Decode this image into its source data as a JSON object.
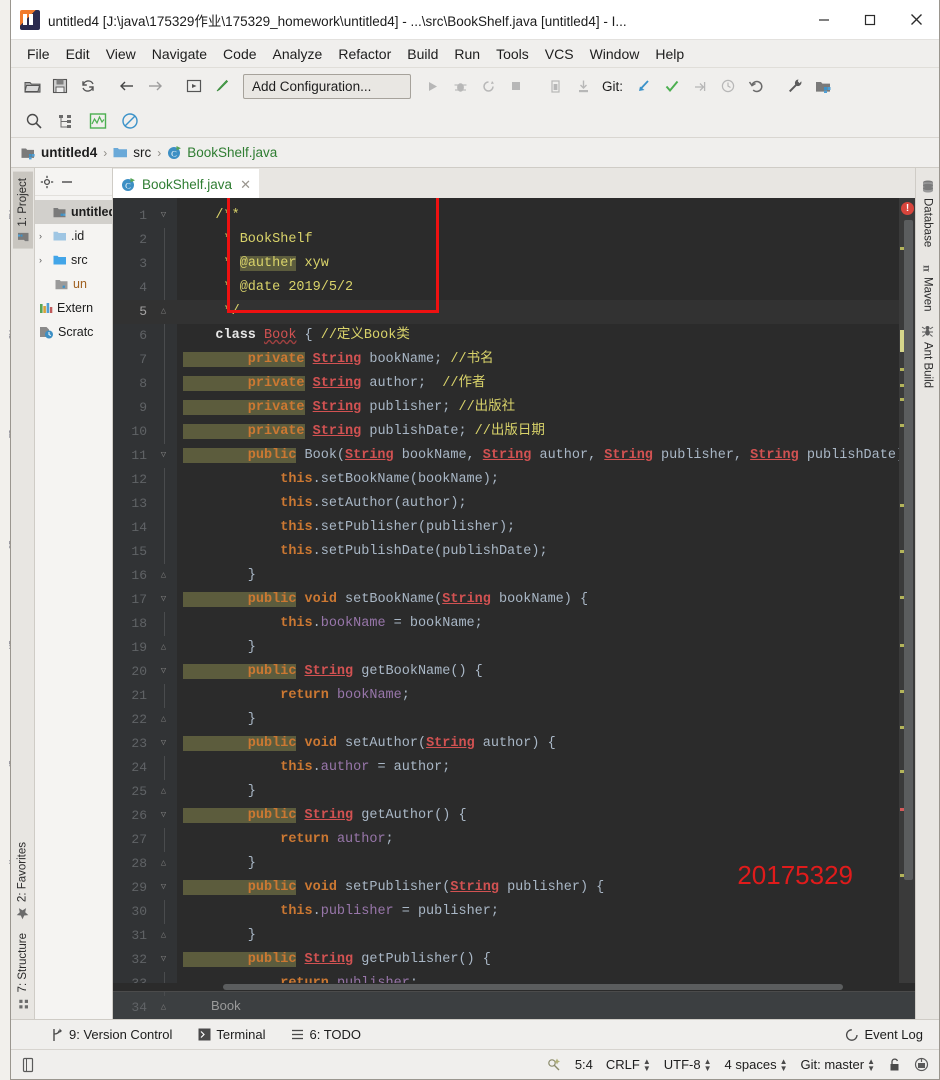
{
  "window": {
    "title": "untitled4 [J:\\java\\175329作业\\175329_homework\\untitled4] - ...\\src\\BookShelf.java [untitled4] - I...",
    "minimize_label": "─",
    "maximize_label": "☐",
    "close_label": "✕",
    "app_icon": "intellij-idea-icon"
  },
  "menubar": {
    "items": [
      {
        "label": "File"
      },
      {
        "label": "Edit"
      },
      {
        "label": "View"
      },
      {
        "label": "Navigate"
      },
      {
        "label": "Code"
      },
      {
        "label": "Analyze"
      },
      {
        "label": "Refactor"
      },
      {
        "label": "Build"
      },
      {
        "label": "Run"
      },
      {
        "label": "Tools"
      },
      {
        "label": "VCS"
      },
      {
        "label": "Window"
      },
      {
        "label": "Help"
      }
    ]
  },
  "toolbar": {
    "run_config": "Add Configuration...",
    "git_label": "Git:",
    "icons": [
      "open-folder-icon",
      "save-all-icon",
      "sync-refresh-icon",
      "back-arrow-icon",
      "forward-arrow-icon",
      "run-anything-icon",
      "build-hammer-icon",
      "run-icon",
      "debug-icon",
      "run-coverage-icon",
      "stop-icon",
      "profiler-icon",
      "attach-process-icon",
      "update-project-icon",
      "commit-icon",
      "push-icon",
      "history-icon",
      "rollback-icon",
      "settings-wrench-icon",
      "project-structure-icon"
    ],
    "row2_icons": [
      "search-everywhere-icon",
      "structure-icon",
      "chart-icon",
      "no-entry-icon"
    ]
  },
  "breadcrumb": {
    "items": [
      {
        "label": "untitled4",
        "icon": "module-icon"
      },
      {
        "label": "src",
        "icon": "folder-icon"
      },
      {
        "label": "BookShelf.java",
        "icon": "java-class-icon"
      }
    ],
    "separator": "›"
  },
  "left_strip": {
    "top": [
      {
        "label": "1: Project",
        "icon": "project-icon",
        "active": true
      }
    ],
    "bottom": [
      {
        "label": "2: Favorites",
        "icon": "star-icon"
      },
      {
        "label": "7: Structure",
        "icon": "structure-grid-icon"
      }
    ]
  },
  "right_strip": {
    "items": [
      {
        "label": "Database",
        "icon": "database-icon"
      },
      {
        "label": "Maven",
        "icon": "maven-m-icon"
      },
      {
        "label": "Ant Build",
        "icon": "ant-icon"
      }
    ]
  },
  "project_panel": {
    "header_icons": [
      "gear-icon",
      "collapse-icon"
    ],
    "tree": [
      {
        "label": "untitled",
        "indent": 0,
        "arrow": "",
        "icon": "module-icon",
        "bold": true,
        "selected": true
      },
      {
        "label": ".id",
        "indent": 1,
        "arrow": "›",
        "icon": "folder-icon",
        "bold": false,
        "selected": false
      },
      {
        "label": "src",
        "indent": 1,
        "arrow": "›",
        "icon": "folder-src-icon",
        "bold": false,
        "selected": false
      },
      {
        "label": "un",
        "indent": 2,
        "arrow": "",
        "icon": "iml-file-icon",
        "bold": false,
        "selected": false,
        "orange": true
      },
      {
        "label": "Extern",
        "indent": 0,
        "arrow": "",
        "icon": "libraries-icon",
        "bold": false,
        "selected": false
      },
      {
        "label": "Scratc",
        "indent": 0,
        "arrow": "",
        "icon": "scratches-icon",
        "bold": false,
        "selected": false
      }
    ]
  },
  "editor": {
    "tab": {
      "label": "BookShelf.java",
      "icon": "java-class-icon",
      "close": "✕"
    },
    "first_line_number": 1,
    "current_line": 5,
    "caret_position": "5:4",
    "bottom_breadcrumb": "Book",
    "watermark": "20175329",
    "error_marker_count": "!",
    "lines": [
      {
        "n": 1,
        "fold": "minus",
        "tokens": [
          {
            "t": "jdoc",
            "s": "    /**"
          }
        ]
      },
      {
        "n": 2,
        "fold": "",
        "tokens": [
          {
            "t": "jdoc",
            "s": "     * BookShelf"
          }
        ]
      },
      {
        "n": 3,
        "fold": "",
        "tokens": [
          {
            "t": "jdoc",
            "s": "     * "
          },
          {
            "t": "jdoct",
            "s": "@auther"
          },
          {
            "t": "jdoc",
            "s": " xyw"
          }
        ]
      },
      {
        "n": 4,
        "fold": "",
        "tokens": [
          {
            "t": "jdoc",
            "s": "     * @date 2019/5/2"
          }
        ]
      },
      {
        "n": 5,
        "fold": "end",
        "tokens": [
          {
            "t": "jdoc",
            "s": "     */"
          }
        ]
      },
      {
        "n": 6,
        "fold": "",
        "tokens": [
          {
            "t": "kwwhite",
            "s": "    class "
          },
          {
            "t": "cls",
            "s": "Book"
          },
          {
            "t": "pln",
            "s": " { "
          },
          {
            "t": "cmt-y",
            "s": "//定义Book类"
          }
        ]
      },
      {
        "n": 7,
        "fold": "",
        "tokens": [
          {
            "t": "kwb",
            "s": "        private"
          },
          {
            "t": "pln",
            "s": " "
          },
          {
            "t": "typ",
            "s": "String"
          },
          {
            "t": "pln",
            "s": " bookName; "
          },
          {
            "t": "cmt-y",
            "s": "//书名"
          }
        ]
      },
      {
        "n": 8,
        "fold": "",
        "tokens": [
          {
            "t": "kwb",
            "s": "        private"
          },
          {
            "t": "pln",
            "s": " "
          },
          {
            "t": "typ",
            "s": "String"
          },
          {
            "t": "pln",
            "s": " author;  "
          },
          {
            "t": "cmt-y",
            "s": "//作者"
          }
        ]
      },
      {
        "n": 9,
        "fold": "",
        "tokens": [
          {
            "t": "kwb",
            "s": "        private"
          },
          {
            "t": "pln",
            "s": " "
          },
          {
            "t": "typ",
            "s": "String"
          },
          {
            "t": "pln",
            "s": " publisher; "
          },
          {
            "t": "cmt-y",
            "s": "//出版社"
          }
        ]
      },
      {
        "n": 10,
        "fold": "",
        "tokens": [
          {
            "t": "kwb",
            "s": "        private"
          },
          {
            "t": "pln",
            "s": " "
          },
          {
            "t": "typ",
            "s": "String"
          },
          {
            "t": "pln",
            "s": " publishDate; "
          },
          {
            "t": "cmt-y",
            "s": "//出版日期"
          }
        ]
      },
      {
        "n": 11,
        "fold": "minus",
        "tokens": [
          {
            "t": "kwb",
            "s": "        public"
          },
          {
            "t": "pln",
            "s": " Book("
          },
          {
            "t": "typ",
            "s": "String"
          },
          {
            "t": "pln",
            "s": " bookName, "
          },
          {
            "t": "typ",
            "s": "String"
          },
          {
            "t": "pln",
            "s": " author, "
          },
          {
            "t": "typ",
            "s": "String"
          },
          {
            "t": "pln",
            "s": " publisher, "
          },
          {
            "t": "typ",
            "s": "String"
          },
          {
            "t": "pln",
            "s": " publishDate) { "
          },
          {
            "t": "cmt-y",
            "s": "//"
          }
        ]
      },
      {
        "n": 12,
        "fold": "",
        "tokens": [
          {
            "t": "kw",
            "s": "            this"
          },
          {
            "t": "pln",
            "s": ".setBookName(bookName);"
          }
        ]
      },
      {
        "n": 13,
        "fold": "",
        "tokens": [
          {
            "t": "kw",
            "s": "            this"
          },
          {
            "t": "pln",
            "s": ".setAuthor(author);"
          }
        ]
      },
      {
        "n": 14,
        "fold": "",
        "tokens": [
          {
            "t": "kw",
            "s": "            this"
          },
          {
            "t": "pln",
            "s": ".setPublisher(publisher);"
          }
        ]
      },
      {
        "n": 15,
        "fold": "",
        "tokens": [
          {
            "t": "kw",
            "s": "            this"
          },
          {
            "t": "pln",
            "s": ".setPublishDate(publishDate);"
          }
        ]
      },
      {
        "n": 16,
        "fold": "end",
        "tokens": [
          {
            "t": "pln",
            "s": "        }"
          }
        ]
      },
      {
        "n": 17,
        "fold": "minus",
        "tokens": [
          {
            "t": "kwb",
            "s": "        public"
          },
          {
            "t": "pln",
            "s": " "
          },
          {
            "t": "kw",
            "s": "void"
          },
          {
            "t": "pln",
            "s": " setBookName("
          },
          {
            "t": "typ",
            "s": "String"
          },
          {
            "t": "pln",
            "s": " bookName) {"
          }
        ]
      },
      {
        "n": 18,
        "fold": "",
        "tokens": [
          {
            "t": "kw",
            "s": "            this"
          },
          {
            "t": "pln",
            "s": "."
          },
          {
            "t": "fld",
            "s": "bookName"
          },
          {
            "t": "pln",
            "s": " = bookName;"
          }
        ]
      },
      {
        "n": 19,
        "fold": "end",
        "tokens": [
          {
            "t": "pln",
            "s": "        }"
          }
        ]
      },
      {
        "n": 20,
        "fold": "minus",
        "tokens": [
          {
            "t": "kwb",
            "s": "        public"
          },
          {
            "t": "pln",
            "s": " "
          },
          {
            "t": "typ",
            "s": "String"
          },
          {
            "t": "pln",
            "s": " getBookName() {"
          }
        ]
      },
      {
        "n": 21,
        "fold": "",
        "tokens": [
          {
            "t": "kw",
            "s": "            return"
          },
          {
            "t": "pln",
            "s": " "
          },
          {
            "t": "fld",
            "s": "bookName"
          },
          {
            "t": "pln",
            "s": ";"
          }
        ]
      },
      {
        "n": 22,
        "fold": "end",
        "tokens": [
          {
            "t": "pln",
            "s": "        }"
          }
        ]
      },
      {
        "n": 23,
        "fold": "minus",
        "tokens": [
          {
            "t": "kwb",
            "s": "        public"
          },
          {
            "t": "pln",
            "s": " "
          },
          {
            "t": "kw",
            "s": "void"
          },
          {
            "t": "pln",
            "s": " setAuthor("
          },
          {
            "t": "typ",
            "s": "String"
          },
          {
            "t": "pln",
            "s": " author) {"
          }
        ]
      },
      {
        "n": 24,
        "fold": "",
        "tokens": [
          {
            "t": "kw",
            "s": "            this"
          },
          {
            "t": "pln",
            "s": "."
          },
          {
            "t": "fld",
            "s": "author"
          },
          {
            "t": "pln",
            "s": " = author;"
          }
        ]
      },
      {
        "n": 25,
        "fold": "end",
        "tokens": [
          {
            "t": "pln",
            "s": "        }"
          }
        ]
      },
      {
        "n": 26,
        "fold": "minus",
        "tokens": [
          {
            "t": "kwb",
            "s": "        public"
          },
          {
            "t": "pln",
            "s": " "
          },
          {
            "t": "typ",
            "s": "String"
          },
          {
            "t": "pln",
            "s": " getAuthor() {"
          }
        ]
      },
      {
        "n": 27,
        "fold": "",
        "tokens": [
          {
            "t": "kw",
            "s": "            return"
          },
          {
            "t": "pln",
            "s": " "
          },
          {
            "t": "fld",
            "s": "author"
          },
          {
            "t": "pln",
            "s": ";"
          }
        ]
      },
      {
        "n": 28,
        "fold": "end",
        "tokens": [
          {
            "t": "pln",
            "s": "        }"
          }
        ]
      },
      {
        "n": 29,
        "fold": "minus",
        "tokens": [
          {
            "t": "kwb",
            "s": "        public"
          },
          {
            "t": "pln",
            "s": " "
          },
          {
            "t": "kw",
            "s": "void"
          },
          {
            "t": "pln",
            "s": " setPublisher("
          },
          {
            "t": "typ",
            "s": "String"
          },
          {
            "t": "pln",
            "s": " publisher) {"
          }
        ]
      },
      {
        "n": 30,
        "fold": "",
        "tokens": [
          {
            "t": "kw",
            "s": "            this"
          },
          {
            "t": "pln",
            "s": "."
          },
          {
            "t": "fld",
            "s": "publisher"
          },
          {
            "t": "pln",
            "s": " = publisher;"
          }
        ]
      },
      {
        "n": 31,
        "fold": "end",
        "tokens": [
          {
            "t": "pln",
            "s": "        }"
          }
        ]
      },
      {
        "n": 32,
        "fold": "minus",
        "tokens": [
          {
            "t": "kwb",
            "s": "        public"
          },
          {
            "t": "pln",
            "s": " "
          },
          {
            "t": "typ",
            "s": "String"
          },
          {
            "t": "pln",
            "s": " getPublisher() {"
          }
        ]
      },
      {
        "n": 33,
        "fold": "",
        "tokens": [
          {
            "t": "kw",
            "s": "            return"
          },
          {
            "t": "pln",
            "s": " "
          },
          {
            "t": "fld",
            "s": "publisher"
          },
          {
            "t": "pln",
            "s": ";"
          }
        ]
      },
      {
        "n": 34,
        "fold": "end",
        "tokens": [
          {
            "t": "pln",
            "s": "        }"
          }
        ]
      }
    ]
  },
  "bottom_bar": {
    "items": [
      {
        "label": "9: Version Control",
        "icon": "version-control-icon"
      },
      {
        "label": "Terminal",
        "icon": "terminal-icon"
      },
      {
        "label": "6: TODO",
        "icon": "todo-icon"
      }
    ],
    "event_log": {
      "label": "Event Log",
      "icon": "event-log-icon"
    }
  },
  "statusbar": {
    "left_icon": "toggle-toolwindow-icon",
    "inspection_icon": "inspections-icon",
    "caret": "5:4",
    "line_separator": "CRLF",
    "encoding": "UTF-8",
    "indent": "4 spaces",
    "branch": "Git: master",
    "lock_icon": "lock-icon",
    "ide_icon": "ide-tips-icon"
  },
  "colors": {
    "editor_bg": "#2b2b2b",
    "gutter_bg": "#313335",
    "accent_red": "#e01b1b",
    "java_green": "#2f7d32",
    "keyword_orange": "#cc7832",
    "javadoc_yellow": "#d9d36a",
    "type_red": "#d25252",
    "field_purple": "#9876aa"
  }
}
